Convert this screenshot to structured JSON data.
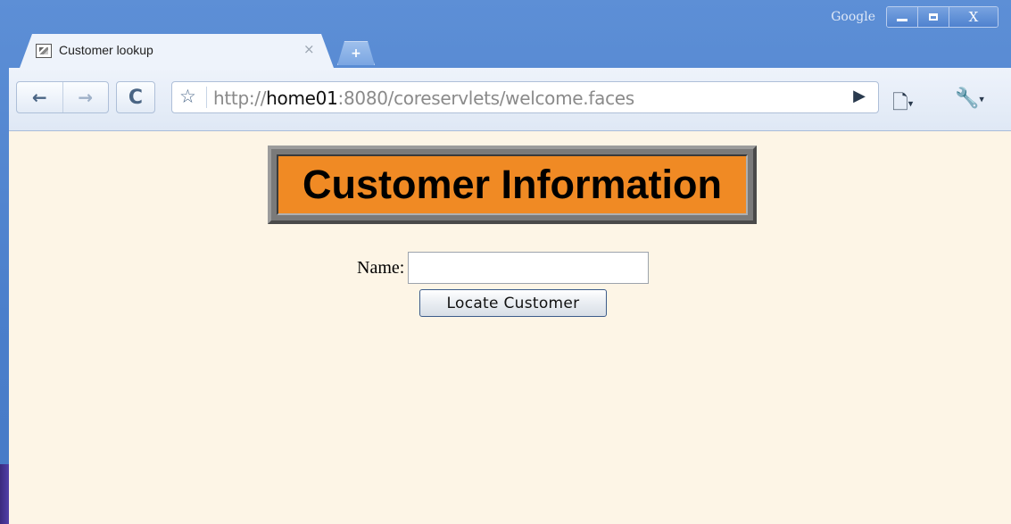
{
  "window": {
    "brand_label": "Google",
    "minimize_label": "",
    "maximize_label": "",
    "close_label": "X"
  },
  "tab": {
    "title": "Customer lookup",
    "close_glyph": "×",
    "new_tab_glyph": "+"
  },
  "toolbar": {
    "back_glyph": "←",
    "forward_glyph": "→",
    "reload_glyph": "C",
    "bookmark_glyph": "☆",
    "url_scheme": "http://",
    "url_host": "home01",
    "url_rest": ":8080/coreservlets/welcome.faces",
    "go_glyph": "▶",
    "page_menu_glyph": "🗋",
    "tools_menu_glyph": "🔧",
    "dropdown_glyph": "▾"
  },
  "page": {
    "heading": "Customer Information",
    "name_label": "Name:",
    "name_value": "",
    "submit_label": "Locate Customer"
  },
  "colors": {
    "frame_blue": "#4b7fcb",
    "page_background": "#fdf5e6",
    "heading_fill": "#f08a24"
  }
}
